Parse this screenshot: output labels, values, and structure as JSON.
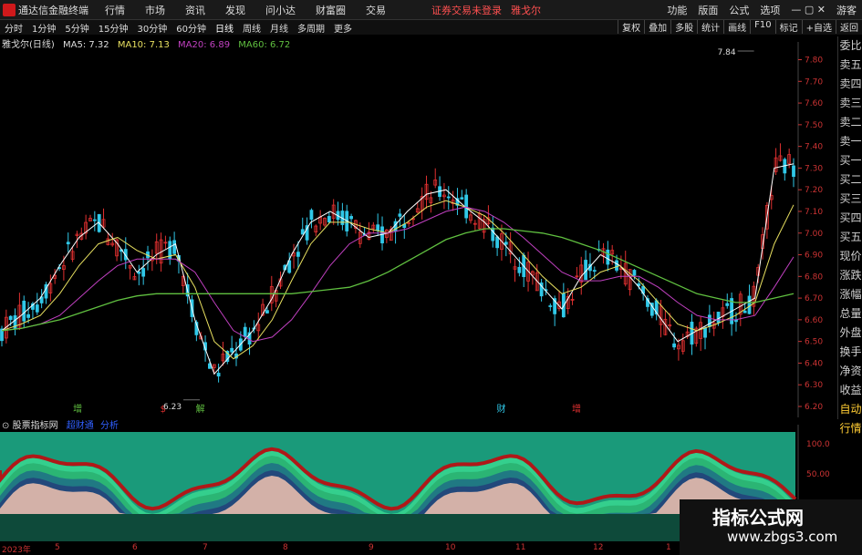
{
  "menubar": {
    "app": "通达信金融终端",
    "menus": [
      "行情",
      "市场",
      "资讯",
      "发现",
      "问小达",
      "财富圈",
      "交易"
    ],
    "warning": "证券交易未登录",
    "stock": "雅戈尔",
    "right": [
      "功能",
      "版面",
      "公式",
      "选项",
      "游客"
    ]
  },
  "periods": [
    "分时",
    "1分钟",
    "5分钟",
    "15分钟",
    "30分钟",
    "60分钟",
    "日线",
    "周线",
    "月线",
    "多周期",
    "更多"
  ],
  "tools": [
    "复权",
    "叠加",
    "多股",
    "统计",
    "画线",
    "F10",
    "标记",
    "+自选",
    "返回"
  ],
  "stockinfo": {
    "name": "雅戈尔(日线)",
    "ma5": "MA5: 7.32",
    "ma10": "MA10: 7.13",
    "ma20": "MA20: 6.89",
    "ma60": "MA60: 6.72"
  },
  "rightpanel": [
    "委比",
    "卖五",
    "卖四",
    "卖三",
    "卖二",
    "卖一",
    "买一",
    "买二",
    "买三",
    "买四",
    "买五",
    "现价",
    "涨跌",
    "涨幅",
    "总量",
    "外盘",
    "换手",
    "净资",
    "收益",
    "自动",
    "行情"
  ],
  "colors": {
    "up": "#e03030",
    "down": "#30c8e8",
    "ma5": "#ffffff",
    "ma10": "#e8e060",
    "ma20": "#c040c0",
    "ma60": "#60c040"
  },
  "chart_data": [
    {
      "type": "candlestick",
      "title": "雅戈尔(日线)",
      "yticks": [
        "7.80",
        "7.70",
        "7.60",
        "7.50",
        "7.40",
        "7.30",
        "7.20",
        "7.10",
        "7.00",
        "6.90",
        "6.80",
        "6.70",
        "6.60",
        "6.50",
        "6.40",
        "6.30",
        "6.20"
      ],
      "ylim": [
        6.2,
        7.84
      ],
      "annotations": [
        {
          "label": "7.84",
          "x": 0.95,
          "y": 7.84
        },
        {
          "label": "6.23",
          "x": 0.25,
          "y": 6.23
        }
      ],
      "events": [
        {
          "label": "增",
          "x": 0.09,
          "color": "#60c040"
        },
        {
          "label": "$",
          "x": 0.2,
          "color": "#e03030"
        },
        {
          "label": "解",
          "x": 0.245,
          "color": "#60c040"
        },
        {
          "label": "财",
          "x": 0.625,
          "color": "#30c8e8"
        },
        {
          "label": "增",
          "x": 0.72,
          "color": "#e03030"
        }
      ],
      "series": [
        {
          "name": "MA5",
          "values": [
            6.55,
            6.62,
            6.7,
            6.85,
            6.98,
            7.05,
            6.95,
            6.82,
            6.9,
            6.95,
            6.6,
            6.35,
            6.45,
            6.55,
            6.7,
            6.9,
            7.05,
            7.1,
            7.05,
            6.98,
            7.0,
            7.1,
            7.18,
            7.2,
            7.12,
            7.05,
            6.95,
            6.85,
            6.75,
            6.65,
            6.8,
            6.9,
            6.85,
            6.75,
            6.62,
            6.5,
            6.55,
            6.6,
            6.65,
            6.7,
            7.3,
            7.32
          ]
        },
        {
          "name": "MA10",
          "values": [
            6.55,
            6.58,
            6.62,
            6.72,
            6.85,
            6.95,
            6.98,
            6.92,
            6.88,
            6.9,
            6.75,
            6.5,
            6.42,
            6.48,
            6.6,
            6.78,
            6.95,
            7.05,
            7.05,
            7.02,
            7.0,
            7.05,
            7.12,
            7.15,
            7.12,
            7.08,
            7.0,
            6.9,
            6.8,
            6.72,
            6.75,
            6.82,
            6.85,
            6.78,
            6.68,
            6.58,
            6.55,
            6.58,
            6.62,
            6.68,
            6.95,
            7.13
          ]
        },
        {
          "name": "MA20",
          "values": [
            6.55,
            6.56,
            6.58,
            6.62,
            6.7,
            6.78,
            6.85,
            6.88,
            6.88,
            6.88,
            6.82,
            6.68,
            6.55,
            6.5,
            6.52,
            6.6,
            6.72,
            6.85,
            6.95,
            7.0,
            7.0,
            7.02,
            7.06,
            7.1,
            7.12,
            7.1,
            7.05,
            6.98,
            6.9,
            6.82,
            6.78,
            6.78,
            6.8,
            6.8,
            6.75,
            6.68,
            6.62,
            6.6,
            6.6,
            6.62,
            6.75,
            6.89
          ]
        },
        {
          "name": "MA60",
          "values": [
            6.55,
            6.56,
            6.58,
            6.6,
            6.63,
            6.66,
            6.69,
            6.71,
            6.72,
            6.72,
            6.72,
            6.72,
            6.72,
            6.72,
            6.72,
            6.72,
            6.73,
            6.74,
            6.75,
            6.78,
            6.82,
            6.87,
            6.92,
            6.97,
            7.0,
            7.02,
            7.02,
            7.01,
            7.0,
            6.98,
            6.95,
            6.92,
            6.88,
            6.84,
            6.8,
            6.76,
            6.72,
            6.7,
            6.68,
            6.68,
            6.7,
            6.72
          ]
        }
      ]
    },
    {
      "type": "area",
      "title": "股票指标网",
      "yticks": [
        "100.0",
        "50.00"
      ],
      "xticks": [
        "2023年",
        "5",
        "6",
        "7",
        "8",
        "9",
        "10",
        "11",
        "12",
        "1"
      ]
    }
  ],
  "volhead": {
    "name": "股票指标网",
    "p1": "超财通",
    "p2": "分析"
  },
  "watermark": {
    "big": "指标公式网",
    "small": "www.zbgs3.com"
  }
}
